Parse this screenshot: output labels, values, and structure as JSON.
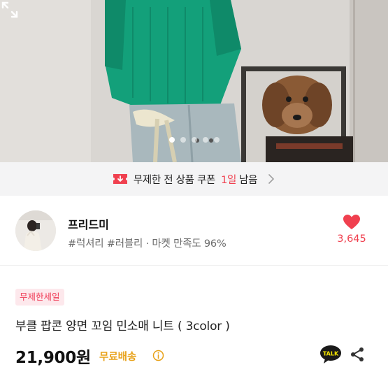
{
  "hero": {
    "page_indicator": {
      "count": 5,
      "active_index": 0
    }
  },
  "coupon": {
    "text": "무제한 전 상품 쿠폰",
    "highlight": "1일",
    "remain": "남음"
  },
  "seller": {
    "name": "프리드미",
    "tags": "#럭셔리 #러블리 · 마켓 만족도 96%",
    "likes": "3,645"
  },
  "product": {
    "badge": "무제한세일",
    "title": "부클 팝콘 양면 꼬임 민소매 니트 ( 3color )",
    "price": "21,900원",
    "shipping": "무료배송",
    "talk_label": "TALK"
  },
  "colors": {
    "accent": "#f0404f",
    "shipping": "#e8a21a",
    "badge_bg": "#fde8ec"
  }
}
